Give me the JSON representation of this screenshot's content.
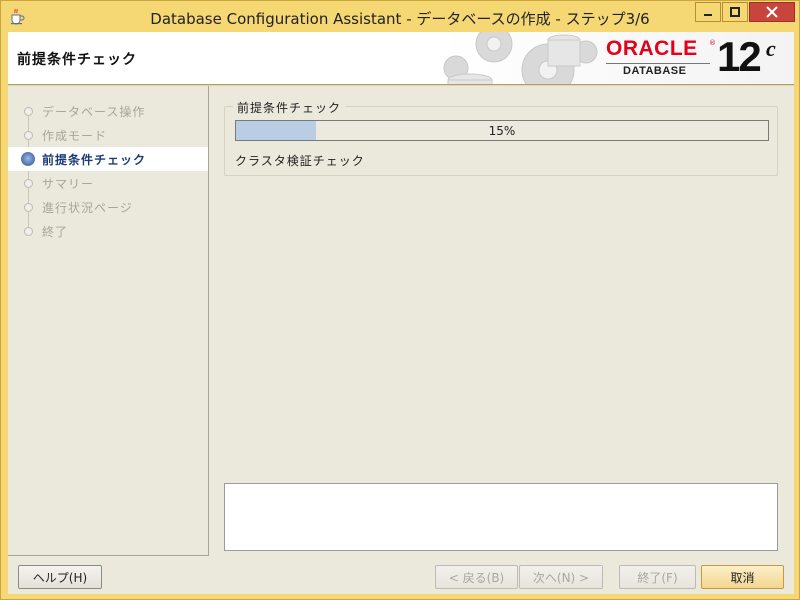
{
  "window": {
    "title": "Database Configuration Assistant - データベースの作成 - ステップ3/6"
  },
  "banner": {
    "page_title": "前提条件チェック",
    "brand": "ORACLE",
    "brand_reg": "®",
    "product": "DATABASE",
    "version": "12",
    "version_sup": "c"
  },
  "sidebar": {
    "steps": [
      {
        "label": "データベース操作",
        "state": "done"
      },
      {
        "label": "作成モード",
        "state": "done"
      },
      {
        "label": "前提条件チェック",
        "state": "active"
      },
      {
        "label": "サマリー",
        "state": "pending"
      },
      {
        "label": "進行状況ページ",
        "state": "pending"
      },
      {
        "label": "終了",
        "state": "pending"
      }
    ]
  },
  "main": {
    "group_title": "前提条件チェック",
    "progress": {
      "value_percent": 15,
      "label": "15%"
    },
    "status_text": "クラスタ検証チェック"
  },
  "footer": {
    "help_label": "ヘルプ(H)",
    "back_label": "< 戻る(B)",
    "next_label": "次へ(N) >",
    "finish_label": "終了(F)",
    "cancel_label": "取消"
  },
  "colors": {
    "title_bar": "#f5d774",
    "close_button": "#c7453c",
    "oracle_red": "#e3001b",
    "active_step": "#1d3b78",
    "progress_fill": "#b9cde5"
  },
  "icons": {
    "app": "java-cup-icon",
    "minimize": "minimize-icon",
    "maximize": "maximize-icon",
    "close": "close-icon",
    "banner_art": "gears-and-database-icon"
  }
}
